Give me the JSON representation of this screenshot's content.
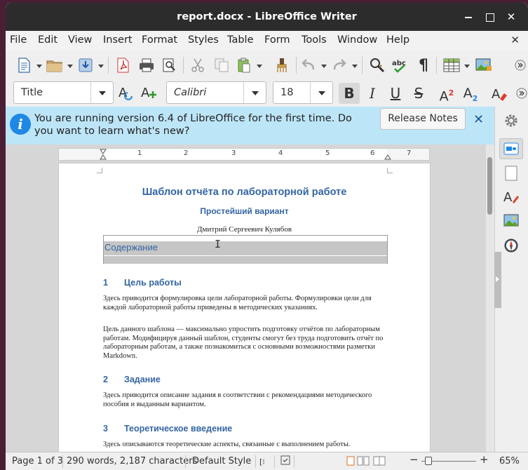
{
  "window": {
    "title": "report.docx - LibreOffice Writer"
  },
  "menu": [
    "File",
    "Edit",
    "View",
    "Insert",
    "Format",
    "Styles",
    "Table",
    "Form",
    "Tools",
    "Window",
    "Help"
  ],
  "toolbar": {
    "paragraph_style": "Title",
    "font_name": "Calibri",
    "font_size": "18",
    "bold": "B",
    "italic": "I",
    "underline": "U",
    "strike": "S",
    "superscript": "A²",
    "subscript": "A₂"
  },
  "infobar": {
    "message": "You are running version 6.4 of LibreOffice for the first time. Do you want to learn what's new?",
    "button": "Release Notes",
    "close": "✕"
  },
  "ruler": {
    "numbers": [
      "1",
      "2",
      "3",
      "4",
      "5",
      "6",
      "7"
    ]
  },
  "document": {
    "title": "Шаблон отчёта по лабораторной работе",
    "subtitle": "Простейший вариант",
    "author": "Дмитрий Сергеевич Кулябов",
    "toc_title": "Содержание",
    "sections": [
      {
        "num": "1",
        "heading": "Цель работы",
        "paragraphs": [
          "Здесь приводится формулировка цели лабораторной работы. Формулировки цели для каждой лабораторной работы приведены в методических указаниях.",
          "Цель данного шаблона — максимально упростить подготовку отчётов по лабораторным работам. Модифицируя данный шаблон, студенты смогут без труда подготовить отчёт по лабораторным работам, а также познакомиться с основными возможностями разметки Markdown."
        ]
      },
      {
        "num": "2",
        "heading": "Задание",
        "paragraphs": [
          "Здесь приводится описание задания в соответствии с рекомендациями методического пособия и выданным вариантом."
        ]
      },
      {
        "num": "3",
        "heading": "Теоретическое введение",
        "paragraphs": [
          "Здесь описываются теоретические аспекты, связанные с выполнением работы."
        ]
      }
    ]
  },
  "status": {
    "page": "Page 1 of 3",
    "words": "290 words, 2,187 characters",
    "style": "Default Style",
    "zoom": "65%"
  },
  "colors": {
    "heading_blue": "#3465a4",
    "infobar_bg": "#bde5f8",
    "titlebar_bg": "#2c2c2c"
  }
}
